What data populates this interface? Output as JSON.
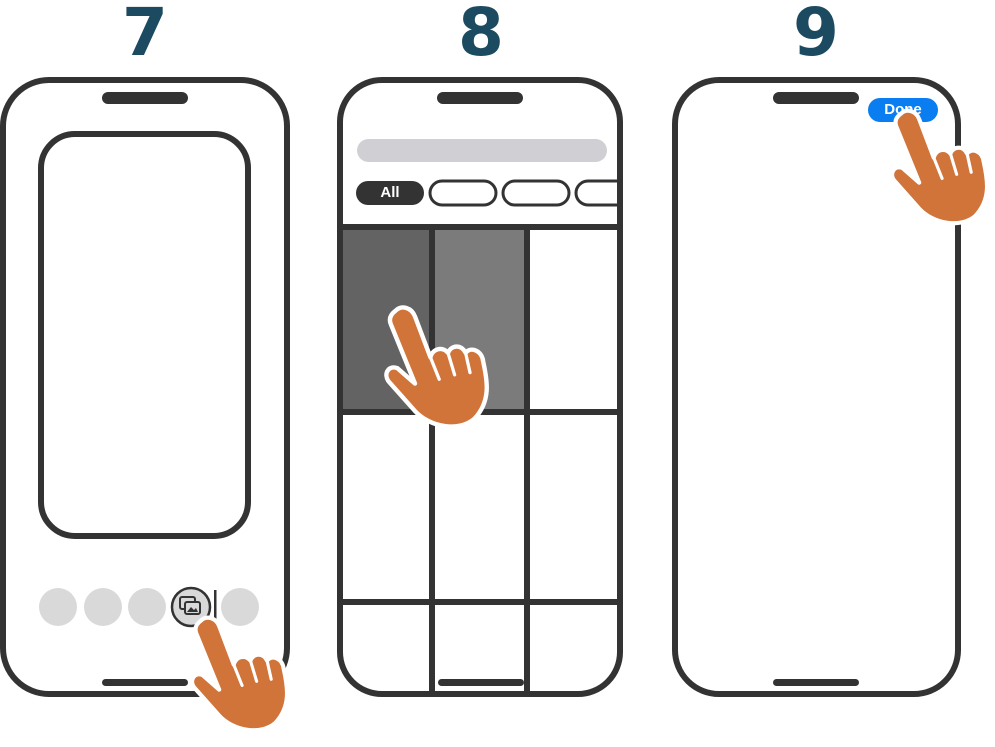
{
  "steps": [
    {
      "number": "7"
    },
    {
      "number": "8"
    },
    {
      "number": "9"
    }
  ],
  "step8": {
    "filter_pills": [
      "All",
      "",
      "",
      ""
    ]
  },
  "step9": {
    "done_label": "Done"
  },
  "colors": {
    "step_number": "#1c4a60",
    "outline": "#333333",
    "hand": "#d0743a",
    "done_button": "#0a7ef0",
    "tile_dark": "#636363",
    "tile_mid": "#7b7b7b",
    "placeholder": "#d9d9d9"
  },
  "icons": [
    "pointing-hand-icon",
    "photo-library-icon"
  ]
}
